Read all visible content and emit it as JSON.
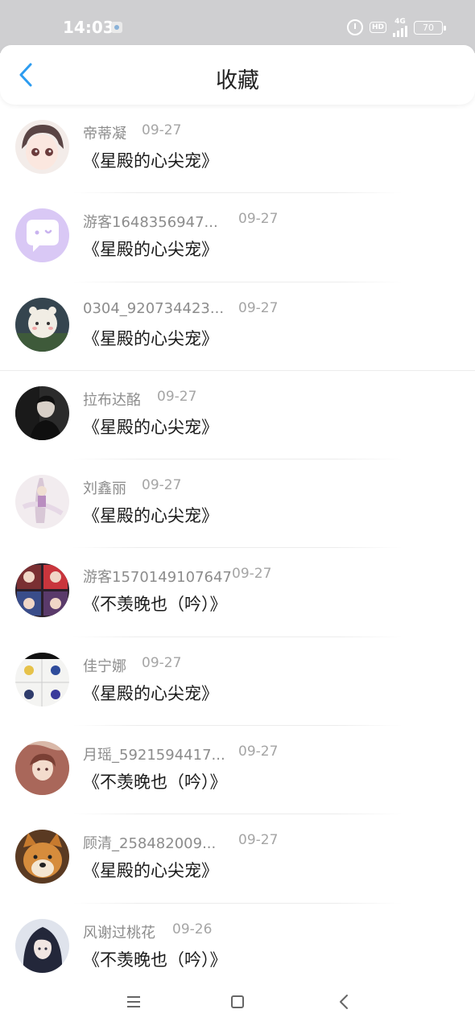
{
  "status_bar": {
    "time": "14:03",
    "network": "4G",
    "hd": "HD",
    "battery": "70"
  },
  "header": {
    "title": "收藏"
  },
  "favorites": [
    {
      "username": "帝蒂凝",
      "date": "09-27",
      "book": "《星殿的心尖宠》"
    },
    {
      "username": "游客1648356947...",
      "date": "09-27",
      "book": "《星殿的心尖宠》"
    },
    {
      "username": "0304_920734423...",
      "date": "09-27",
      "book": "《星殿的心尖宠》"
    },
    {
      "username": "拉布达酩",
      "date": "09-27",
      "book": "《星殿的心尖宠》"
    },
    {
      "username": "刘鑫丽",
      "date": "09-27",
      "book": "《星殿的心尖宠》"
    },
    {
      "username": "游客1570149107647",
      "date": "09-27",
      "book": "《不羡晚也（吟）》"
    },
    {
      "username": "佳宁娜",
      "date": "09-27",
      "book": "《星殿的心尖宠》"
    },
    {
      "username": "月瑶_5921594417...",
      "date": "09-27",
      "book": "《不羡晚也（吟）》"
    },
    {
      "username": "顾清_258482009...",
      "date": "09-27",
      "book": "《星殿的心尖宠》"
    },
    {
      "username": "风谢过桃花",
      "date": "09-26",
      "book": "《不羡晚也（吟）》"
    }
  ],
  "colors": {
    "accent": "#2d9cf0",
    "status_bar_bg": "#cfcfd1",
    "username_text": "#8c8c8c",
    "date_text": "#a5a5a5",
    "title_text": "#1a1a1a"
  },
  "icons": {
    "back": "chevron-left-icon",
    "nav_menu": "menu-icon",
    "nav_home": "home-square-icon",
    "nav_back": "back-triangle-icon"
  }
}
